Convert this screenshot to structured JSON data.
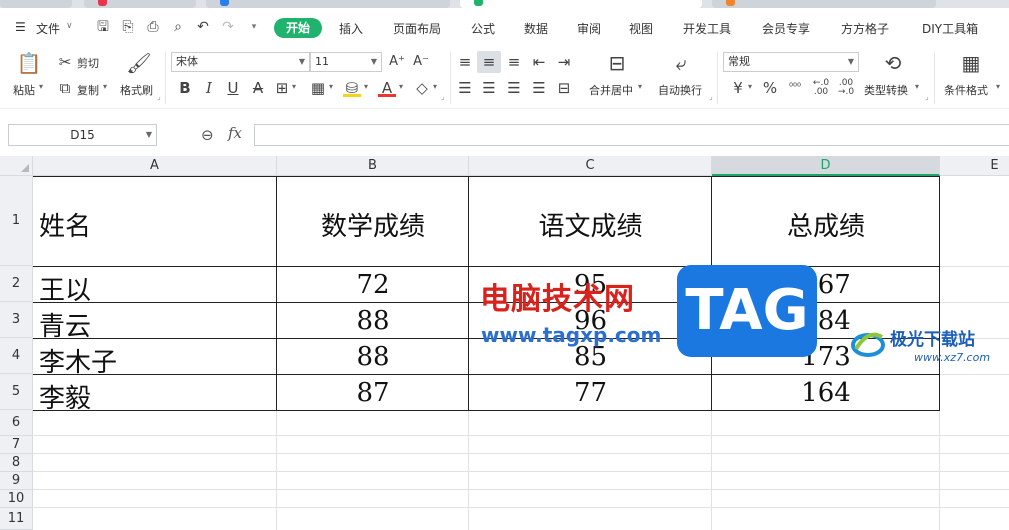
{
  "menu": {
    "file_label": "文件",
    "tabs": [
      {
        "label": "开始",
        "active": true
      },
      {
        "label": "插入"
      },
      {
        "label": "页面布局"
      },
      {
        "label": "公式"
      },
      {
        "label": "数据"
      },
      {
        "label": "审阅"
      },
      {
        "label": "视图"
      },
      {
        "label": "开发工具"
      },
      {
        "label": "会员专享"
      },
      {
        "label": "方方格子"
      },
      {
        "label": "DIY工具箱"
      }
    ]
  },
  "ribbon": {
    "paste": "粘贴",
    "cut": "剪切",
    "copy": "复制",
    "format_painter": "格式刷",
    "font_name": "宋体",
    "font_size": "11",
    "merge_center": "合并居中",
    "wrap_text": "自动换行",
    "number_format": "常规",
    "type_convert": "类型转换",
    "conditional_format": "条件格式"
  },
  "formula_bar": {
    "name_box": "D15",
    "fx": "fx",
    "formula": ""
  },
  "sheet": {
    "columns": [
      "A",
      "B",
      "C",
      "D",
      "E"
    ],
    "selected_column": "D",
    "rows": [
      "1",
      "2",
      "3",
      "4",
      "5",
      "6",
      "7",
      "8",
      "9",
      "10",
      "11"
    ],
    "header": [
      "姓名",
      "数学成绩",
      "语文成绩",
      "总成绩"
    ],
    "data": [
      [
        "王以",
        "72",
        "95",
        "167"
      ],
      [
        "青云",
        "88",
        "96",
        "184"
      ],
      [
        "李木子",
        "88",
        "85",
        "173"
      ],
      [
        "李毅",
        "87",
        "77",
        "164"
      ]
    ]
  },
  "watermark": {
    "site_cn": "电脑技术网",
    "site_url": "www.tagxp.com",
    "tag_text": "TAG",
    "brand2": "极光下载站",
    "brand2_url": "www.xz7.com"
  },
  "colors": {
    "accent": "#1fb36e",
    "selected_col": "#1fa36a"
  }
}
